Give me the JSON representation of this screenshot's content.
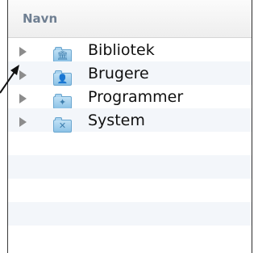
{
  "header": {
    "column_label": "Navn"
  },
  "items": [
    {
      "label": "Bibliotek",
      "icon": "library-folder-icon",
      "glyph": "🏛"
    },
    {
      "label": "Brugere",
      "icon": "users-folder-icon",
      "glyph": "👤"
    },
    {
      "label": "Programmer",
      "icon": "applications-folder-icon",
      "glyph": "✦"
    },
    {
      "label": "System",
      "icon": "system-folder-icon",
      "glyph": "✕"
    }
  ],
  "colors": {
    "header_text": "#6f7f92",
    "folder": "#8cc2e6",
    "disclosure": "#8c8c8c"
  }
}
